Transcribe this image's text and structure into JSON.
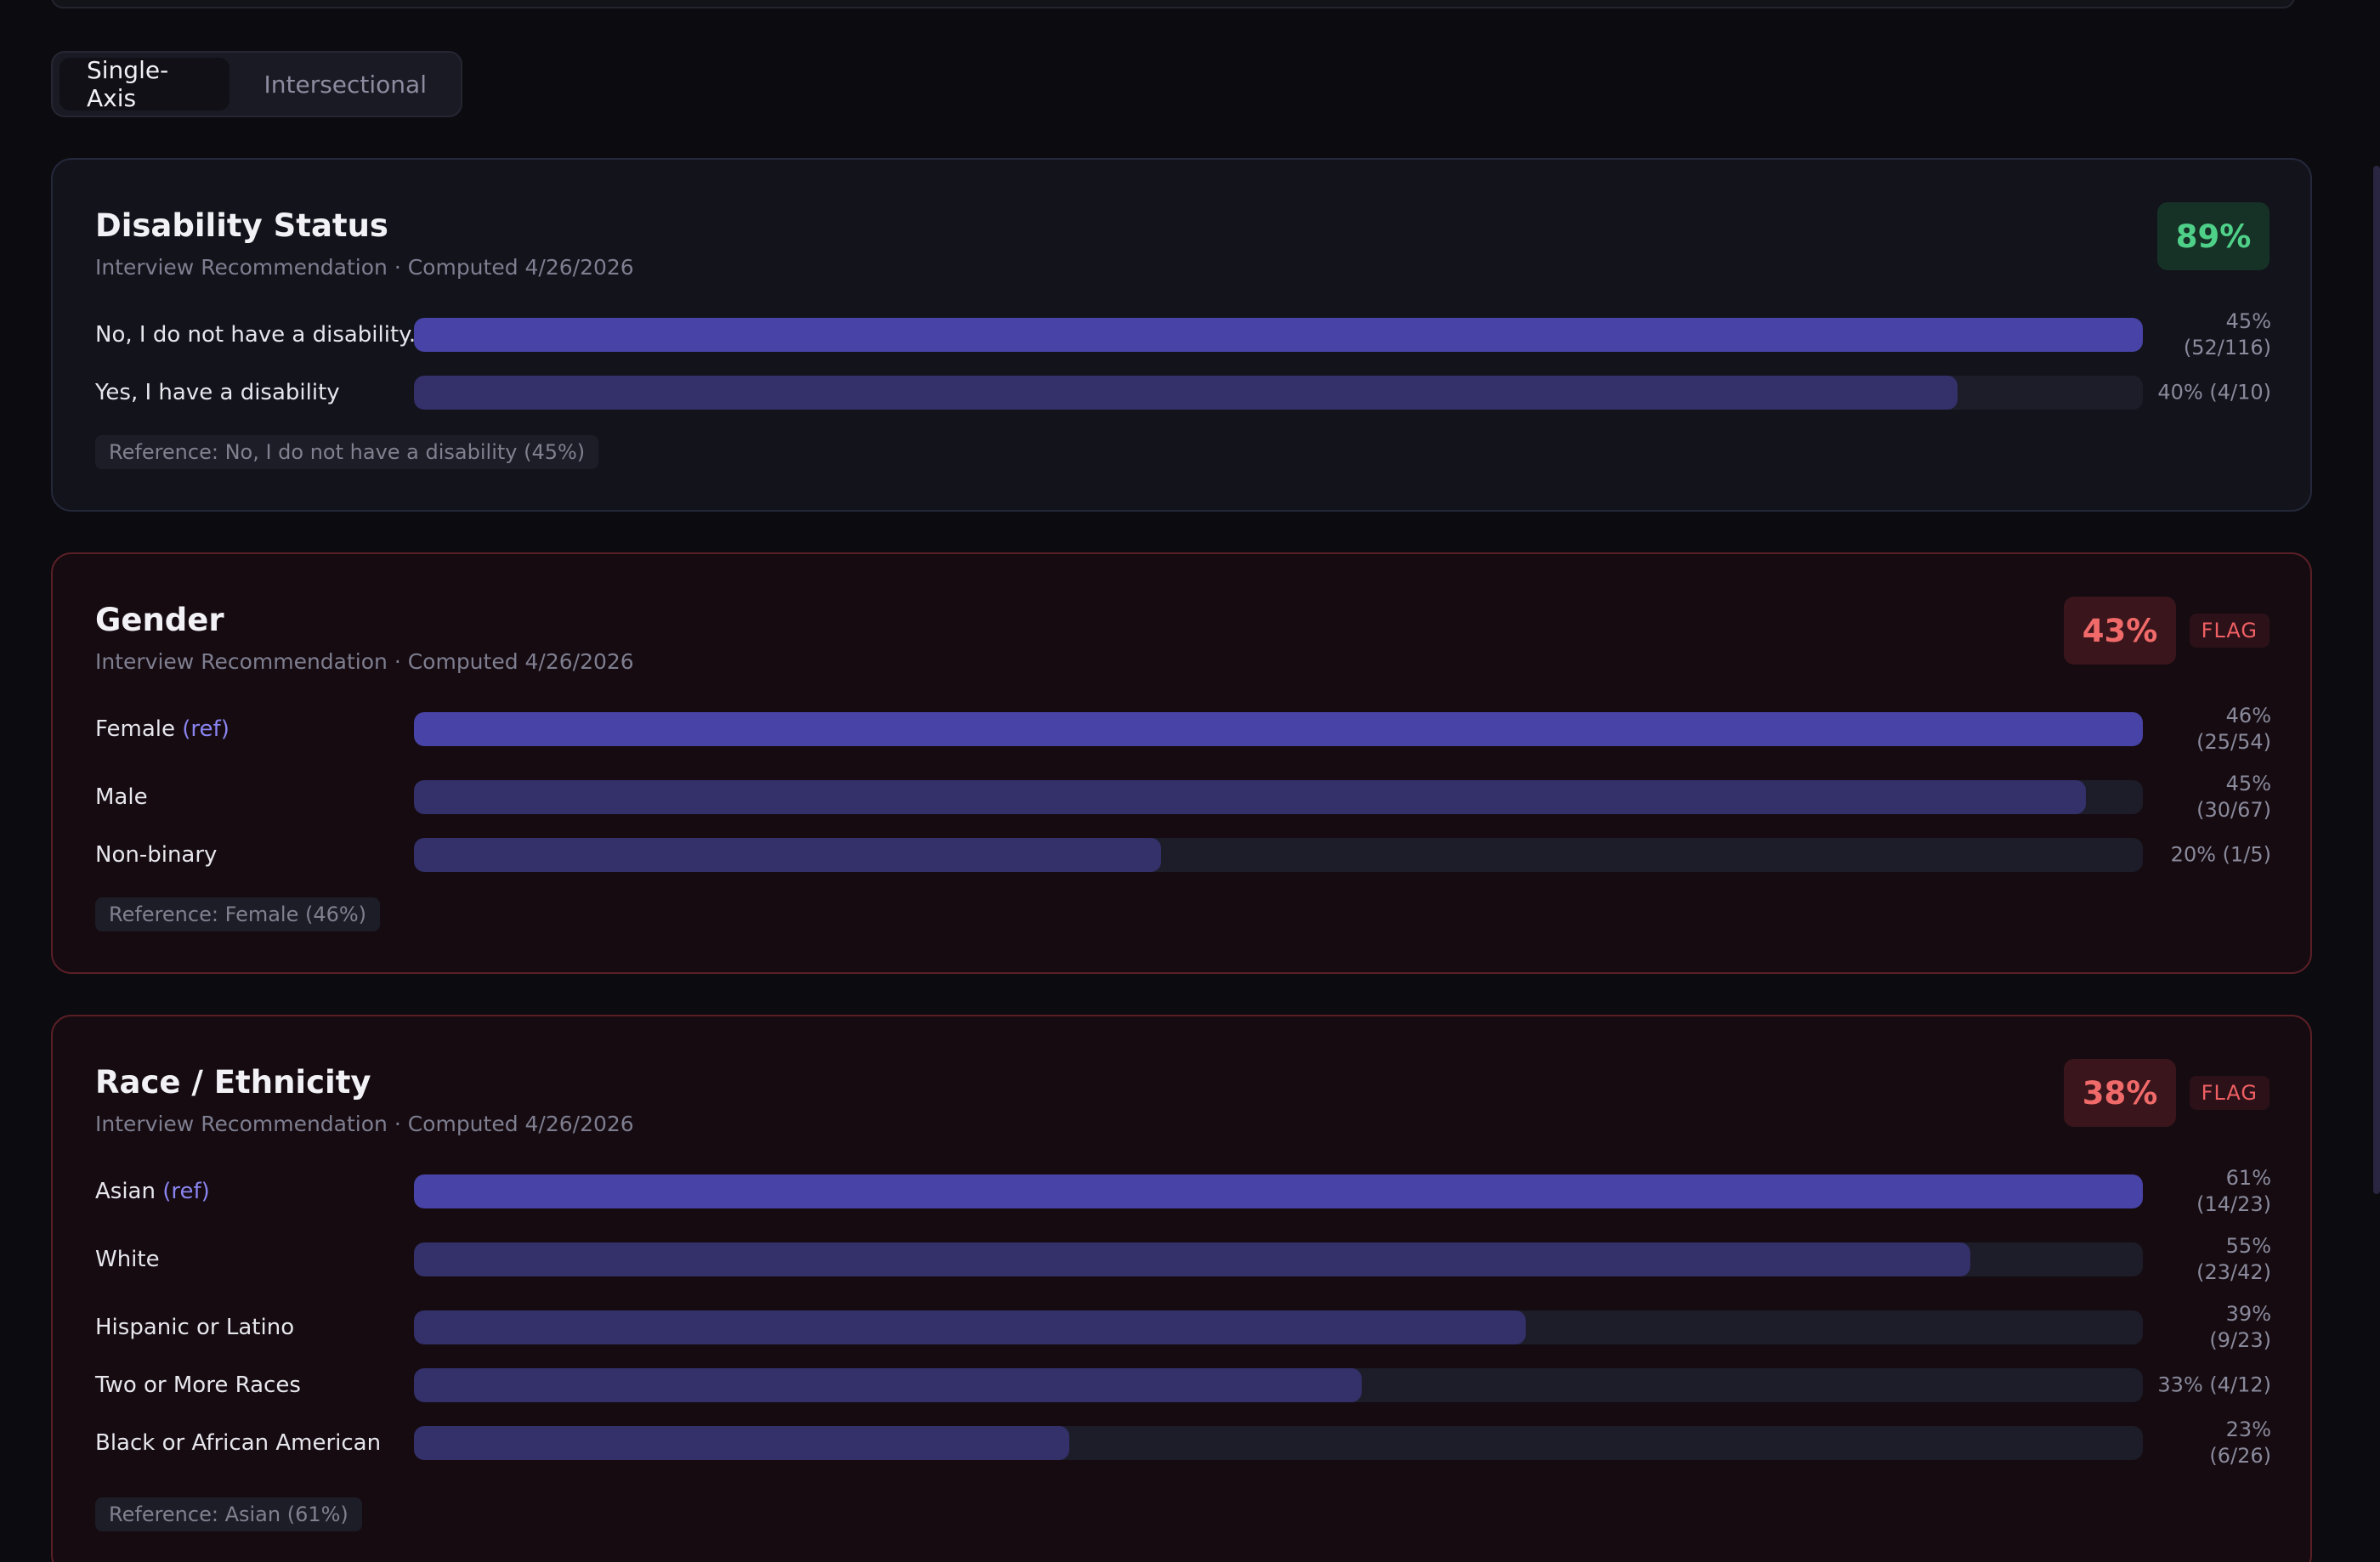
{
  "tabs": [
    {
      "label": "Single-Axis",
      "active": true
    },
    {
      "label": "Intersectional",
      "active": false
    }
  ],
  "cards": [
    {
      "title": "Disability Status",
      "subtitle": "Interview Recommendation · Computed 4/26/2026",
      "score": "89%",
      "status": "good",
      "rows": [
        {
          "label": "No, I do not have a disability...",
          "ref_tag": "",
          "pct_line1": "45%",
          "pct_line2": "(52/116)",
          "fill_fraction": 1.0,
          "is_ref": true
        },
        {
          "label": "Yes, I have a disability",
          "ref_tag": "",
          "pct_line1": "40% (4/10)",
          "pct_line2": "",
          "fill_fraction": 0.893,
          "is_ref": false
        }
      ],
      "reference": "Reference: No, I do not have a disability (45%)"
    },
    {
      "title": "Gender",
      "subtitle": "Interview Recommendation · Computed 4/26/2026",
      "score": "43%",
      "status": "bad",
      "flag": "FLAG",
      "rows": [
        {
          "label": "Female",
          "ref_tag": "(ref)",
          "pct_line1": "46%",
          "pct_line2": "(25/54)",
          "fill_fraction": 1.0,
          "is_ref": true
        },
        {
          "label": "Male",
          "ref_tag": "",
          "pct_line1": "45%",
          "pct_line2": "(30/67)",
          "fill_fraction": 0.967,
          "is_ref": false
        },
        {
          "label": "Non-binary",
          "ref_tag": "",
          "pct_line1": "20% (1/5)",
          "pct_line2": "",
          "fill_fraction": 0.432,
          "is_ref": false
        }
      ],
      "reference": "Reference: Female (46%)"
    },
    {
      "title": "Race / Ethnicity",
      "subtitle": "Interview Recommendation · Computed 4/26/2026",
      "score": "38%",
      "status": "bad",
      "flag": "FLAG",
      "rows": [
        {
          "label": "Asian",
          "ref_tag": "(ref)",
          "pct_line1": "61%",
          "pct_line2": "(14/23)",
          "fill_fraction": 1.0,
          "is_ref": true
        },
        {
          "label": "White",
          "ref_tag": "",
          "pct_line1": "55%",
          "pct_line2": "(23/42)",
          "fill_fraction": 0.9,
          "is_ref": false
        },
        {
          "label": "Hispanic or Latino",
          "ref_tag": "",
          "pct_line1": "39%",
          "pct_line2": "(9/23)",
          "fill_fraction": 0.643,
          "is_ref": false
        },
        {
          "label": "Two or More Races",
          "ref_tag": "",
          "pct_line1": "33% (4/12)",
          "pct_line2": "",
          "fill_fraction": 0.548,
          "is_ref": false
        },
        {
          "label": "Black or African American",
          "ref_tag": "",
          "pct_line1": "23%",
          "pct_line2": "(6/26)",
          "fill_fraction": 0.379,
          "is_ref": false
        }
      ],
      "reference": "Reference: Asian (61%)"
    }
  ]
}
